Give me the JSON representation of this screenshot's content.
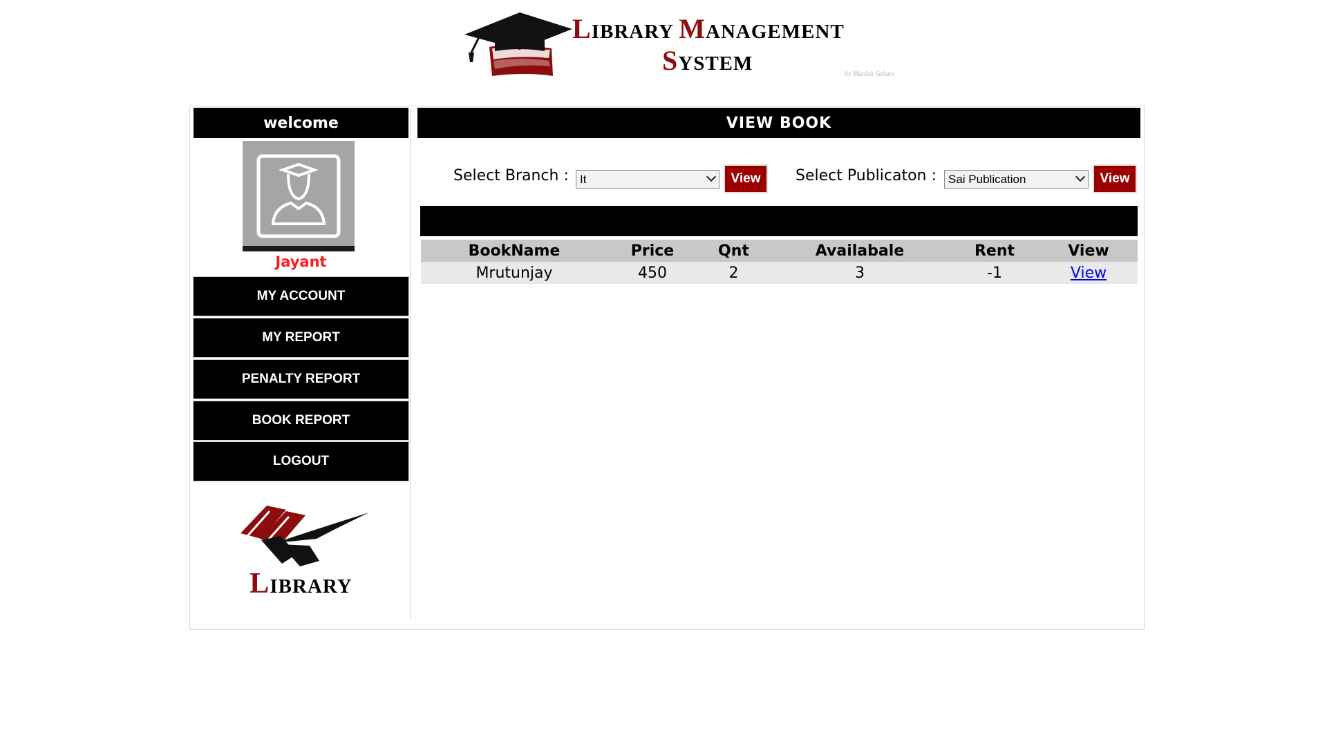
{
  "header": {
    "title_line1": {
      "cap1": "L",
      "rest1": "IBRARY ",
      "cap2": "M",
      "rest2": "ANAGEMENT"
    },
    "title_line2": {
      "cap": "S",
      "rest": "YSTEM"
    },
    "byline": "by Manish Sahani"
  },
  "sidebar": {
    "welcome": "welcome",
    "user_name": "Jayant",
    "menu": {
      "my_account": "MY ACCOUNT",
      "my_report": "MY REPORT",
      "penalty_report": "PENALTY REPORT",
      "book_report": "BOOK REPORT",
      "logout": "LOGOUT"
    },
    "logo_text": {
      "cap": "L",
      "rest": "IBRARY"
    }
  },
  "main": {
    "title": "VIEW BOOK",
    "branch": {
      "label": "Select Branch :",
      "selected": "It",
      "button": "View"
    },
    "publication": {
      "label": "Select Publicaton :",
      "selected": "Sai Publication",
      "button": "View"
    },
    "table": {
      "columns": [
        "BookName",
        "Price",
        "Qnt",
        "Availabale",
        "Rent",
        "View"
      ],
      "rows": [
        {
          "book_name": "Mrutunjay",
          "price": "450",
          "qnt": "2",
          "available": "3",
          "rent": "-1",
          "view": "View"
        }
      ]
    }
  },
  "colors": {
    "accent": "#8b0d0d",
    "button_red": "#9a0000",
    "user_name": "#ff1a1a",
    "bar": "#000000"
  }
}
